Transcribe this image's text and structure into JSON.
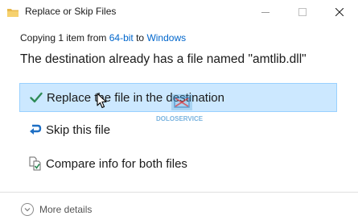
{
  "window": {
    "title": "Replace or Skip Files"
  },
  "copy_status": {
    "prefix": "Copying 1 item from ",
    "source": "64-bit",
    "middle": " to ",
    "destination": "Windows"
  },
  "heading": "The destination already has a file named \"amtlib.dll\"",
  "options": {
    "replace": {
      "label": "Replace the file in the destination",
      "icon": "checkmark-icon",
      "highlight": "#cce8ff"
    },
    "skip": {
      "label": "Skip this file",
      "icon": "skip-arrow-icon"
    },
    "compare": {
      "label": "Compare info for both files",
      "icon": "compare-files-icon"
    }
  },
  "footer": {
    "more_details": "More details"
  },
  "watermark": {
    "text": "DOLOSERVICE"
  },
  "colors": {
    "link": "#0066cc",
    "accent_green": "#2e8b57",
    "skip_blue": "#1e6fc4"
  }
}
